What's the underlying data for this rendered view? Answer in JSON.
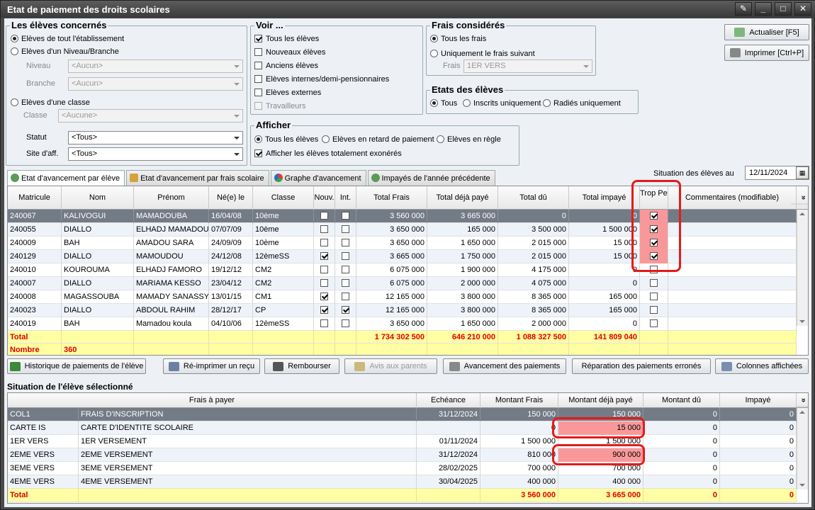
{
  "window": {
    "title": "Etat de paiement des droits scolaires"
  },
  "eleves": {
    "title": "Les élèves concernés",
    "opt_all": "Elèves de tout l'établissement",
    "opt_niveau": "Elèves d'un Niveau/Branche",
    "niveau_label": "Niveau",
    "niveau_value": "<Aucun>",
    "branche_label": "Branche",
    "branche_value": "<Aucun>",
    "opt_classe": "Elèves d'une classe",
    "classe_label": "Classe",
    "classe_value": "<Aucune>",
    "statut_label": "Statut",
    "statut_value": "<Tous>",
    "site_label": "Site d'aff.",
    "site_value": "<Tous>"
  },
  "voir": {
    "title": "Voir ...",
    "items": [
      {
        "label": "Tous les élèves",
        "checked": true
      },
      {
        "label": "Nouveaux élèves",
        "checked": false
      },
      {
        "label": "Anciens élèves",
        "checked": false
      },
      {
        "label": "Elèves internes/demi-pensionnaires",
        "checked": false
      },
      {
        "label": "Elèves externes",
        "checked": false
      },
      {
        "label": "Travailleurs",
        "checked": false,
        "disabled": true
      }
    ]
  },
  "frais": {
    "title": "Frais considérés",
    "opt_all": "Tous les frais",
    "opt_one": "Uniquement le frais suivant",
    "frais_label": "Frais",
    "frais_value": "1ER VERS"
  },
  "etats": {
    "title": "Etats des élèves",
    "tous": "Tous",
    "inscrits": "Inscrits uniquement",
    "radies": "Radiés uniquement"
  },
  "afficher": {
    "title": "Afficher",
    "opt_all": "Tous les élèves",
    "opt_retard": "Elèves en retard de paiement",
    "opt_regle": "Elèves en règle",
    "exoneres": "Afficher les élèves totalement exonérés"
  },
  "actions": {
    "refresh": "Actualiser [F5]",
    "print": "Imprimer [Ctrl+P]"
  },
  "tabs": [
    "Etat d'avancement par élève",
    "Etat d'avancement par frais scolaire",
    "Graphe d'avancement",
    "Impayés de l'année précédente"
  ],
  "situation": {
    "label": "Situation des élèves au",
    "date": "12/11/2024"
  },
  "table": {
    "headers": [
      "Matricule",
      "Nom",
      "Prénom",
      "Né(e) le",
      "Classe",
      "Nouv.",
      "Int.",
      "Total Frais",
      "Total déjà payé",
      "Total dû",
      "Total impayé",
      "Trop Perçu",
      "Commentaires (modifiable)"
    ],
    "rows": [
      {
        "matricule": "240067",
        "nom": "KALIVOGUI",
        "prenom": "MAMADOUBA",
        "ne": "16/04/08",
        "classe": "10ème",
        "nouv": false,
        "int": false,
        "frais": "3 560 000",
        "paye": "3 665 000",
        "du": "0",
        "impaye": "0",
        "trop": true
      },
      {
        "matricule": "240055",
        "nom": "DIALLO",
        "prenom": "ELHADJ MAMADOU",
        "ne": "07/07/09",
        "classe": "10ème",
        "nouv": false,
        "int": false,
        "frais": "3 650 000",
        "paye": "165 000",
        "du": "3 500 000",
        "impaye": "1 500 000",
        "trop": true
      },
      {
        "matricule": "240009",
        "nom": "BAH",
        "prenom": "AMADOU SARA",
        "ne": "24/09/09",
        "classe": "10ème",
        "nouv": false,
        "int": false,
        "frais": "3 650 000",
        "paye": "1 650 000",
        "du": "2 015 000",
        "impaye": "15 000",
        "trop": true
      },
      {
        "matricule": "240129",
        "nom": "DIALLO",
        "prenom": "MAMOUDOU",
        "ne": "24/12/08",
        "classe": "12èmeSS",
        "nouv": true,
        "int": false,
        "frais": "3 665 000",
        "paye": "1 750 000",
        "du": "2 015 000",
        "impaye": "15 000",
        "trop": true
      },
      {
        "matricule": "240010",
        "nom": "KOUROUMA",
        "prenom": "ELHADJ FAMORO",
        "ne": "19/12/12",
        "classe": "CM2",
        "nouv": false,
        "int": false,
        "frais": "6 075 000",
        "paye": "1 900 000",
        "du": "4 175 000",
        "impaye": "0",
        "trop": false
      },
      {
        "matricule": "240007",
        "nom": "DIALLO",
        "prenom": "MARIAMA KESSO",
        "ne": "23/04/12",
        "classe": "CM2",
        "nouv": false,
        "int": false,
        "frais": "6 075 000",
        "paye": "2 000 000",
        "du": "4 075 000",
        "impaye": "0",
        "trop": false
      },
      {
        "matricule": "240008",
        "nom": "MAGASSOUBA",
        "prenom": "MAMADY SANASSY",
        "ne": "13/01/15",
        "classe": "CM1",
        "nouv": true,
        "int": false,
        "frais": "12 165 000",
        "paye": "3 800 000",
        "du": "8 365 000",
        "impaye": "165 000",
        "trop": false
      },
      {
        "matricule": "240023",
        "nom": "DIALLO",
        "prenom": "ABDOUL RAHIM",
        "ne": "28/12/17",
        "classe": "CP",
        "nouv": true,
        "int": true,
        "frais": "12 165 000",
        "paye": "3 800 000",
        "du": "8 365 000",
        "impaye": "165 000",
        "trop": false
      },
      {
        "matricule": "240019",
        "nom": "BAH",
        "prenom": "Mamadou koula",
        "ne": "04/10/06",
        "classe": "12èmeSS",
        "nouv": false,
        "int": false,
        "frais": "3 650 000",
        "paye": "1 650 000",
        "du": "2 000 000",
        "impaye": "0",
        "trop": false
      }
    ],
    "total_label": "Total",
    "nombre_label": "Nombre",
    "nombre_value": "360",
    "total_frais": "1 734 302 500",
    "total_paye": "646 210 000",
    "total_du": "1 088 327 500",
    "total_impaye": "141 809 040"
  },
  "buttons": [
    "Historique de paiements de l'élève",
    "Ré-imprimer un reçu",
    "Rembourser",
    "Avis aux parents",
    "Avancement des paiements",
    "Réparation des paiements erronés",
    "Colonnes affichées"
  ],
  "detail": {
    "title": "Situation de l'élève sélectionné",
    "headers": [
      "Frais à payer",
      "Echéance",
      "Montant Frais",
      "Montant déjà payé",
      "Montant dû",
      "Impayé"
    ],
    "rows": [
      {
        "code": "COL1",
        "label": "FRAIS D'INSCRIPTION",
        "echeance": "31/12/2024",
        "frais": "150 000",
        "paye": "150 000",
        "du": "0",
        "impaye": "0"
      },
      {
        "code": "CARTE IS",
        "label": "CARTE D'IDENTITE SCOLAIRE",
        "echeance": "",
        "frais": "0",
        "paye": "15 000",
        "du": "0",
        "impaye": "0"
      },
      {
        "code": "1ER VERS",
        "label": "1ER VERSEMENT",
        "echeance": "01/11/2024",
        "frais": "1 500 000",
        "paye": "1 500 000",
        "du": "0",
        "impaye": "0"
      },
      {
        "code": "2EME VERS",
        "label": "2EME VERSEMENT",
        "echeance": "31/12/2024",
        "frais": "810 000",
        "paye": "900 000",
        "du": "0",
        "impaye": "0"
      },
      {
        "code": "3EME VERS",
        "label": "3EME VERSEMENT",
        "echeance": "28/02/2025",
        "frais": "700 000",
        "paye": "700 000",
        "du": "0",
        "impaye": "0"
      },
      {
        "code": "4EME VERS",
        "label": "4EME VERSEMENT",
        "echeance": "30/04/2025",
        "frais": "400 000",
        "paye": "400 000",
        "du": "0",
        "impaye": "0"
      }
    ],
    "total_label": "Total",
    "total_frais": "3 560 000",
    "total_paye": "3 665 000",
    "total_du": "0",
    "total_impaye": "0"
  }
}
